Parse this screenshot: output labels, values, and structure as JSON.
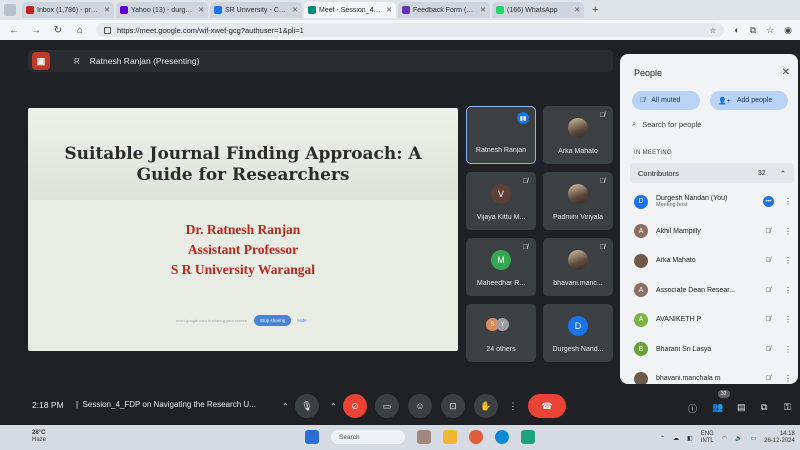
{
  "browser": {
    "tabs": [
      {
        "label": "Inbox (1,786) - prof.durgesh",
        "color": "#c5221f",
        "active": false
      },
      {
        "label": "Yahoo (13) - durgeshnan",
        "color": "#6001d2",
        "active": false
      },
      {
        "label": "SR University - Calendar",
        "color": "#1a73e8",
        "active": false
      },
      {
        "label": "Meet - Session_4_FD",
        "color": "#e8eaed",
        "active": true
      },
      {
        "label": "Feedback Form (Session",
        "color": "#6733b9",
        "active": false
      },
      {
        "label": "(166) WhatsApp",
        "color": "#25d366",
        "active": false
      }
    ],
    "url": "https://meet.google.com/wif-xwef-gcg?authuser=1&pli=1"
  },
  "presenter": {
    "initial": "R",
    "label": "Ratnesh Ranjan (Presenting)"
  },
  "slide": {
    "title_line1": "Suitable Journal Finding Approach: A",
    "title_line2": "Guide for Researchers",
    "author": "Dr. Ratnesh Ranjan",
    "role": "Assistant Professor",
    "org": "S R University Warangal",
    "share_note": "meet.google.com is sharing your screen.",
    "stop_label": "Stop sharing",
    "hide_label": "Hide"
  },
  "tiles": [
    {
      "name": "Ratnesh Ranjan",
      "avatar": "",
      "speaking": true
    },
    {
      "name": "Arka Mahato",
      "avatar": "photo"
    },
    {
      "name": "Vijaya Kittu M...",
      "avatar": "V",
      "color": "#5d4037"
    },
    {
      "name": "Padmini Viriyala",
      "avatar": "photo"
    },
    {
      "name": "Maheedhar R...",
      "avatar": "M",
      "color": "#34a853"
    },
    {
      "name": "bhavani.manc...",
      "avatar": "photo"
    },
    {
      "name": "24 others",
      "a1": "S",
      "a2": "Y"
    },
    {
      "name": "Durgesh Nand...",
      "avatar": "D",
      "color": "#1a73e8"
    }
  ],
  "people": {
    "header": "People",
    "all_muted": "All muted",
    "add_people": "Add people",
    "search_placeholder": "Search for people",
    "section": "IN MEETING",
    "group_label": "Contributors",
    "group_count": "32",
    "list": [
      {
        "name": "Durgesh Nandan (You)",
        "sub": "Meeting host",
        "initial": "D",
        "color": "#1a73e8"
      },
      {
        "name": "Akhil Mampilly",
        "sub": "",
        "initial": "A",
        "color": "#8d6e63"
      },
      {
        "name": "Arka Mahato",
        "sub": "",
        "initial": "",
        "color": "#6d5a4a"
      },
      {
        "name": "Associate Dean Resear...",
        "sub": "",
        "initial": "A",
        "color": "#8d6e63"
      },
      {
        "name": "AVANIKETH P",
        "sub": "",
        "initial": "A",
        "color": "#7cb342"
      },
      {
        "name": "Bharani Sri Lasya",
        "sub": "",
        "initial": "B",
        "color": "#689f38"
      },
      {
        "name": "bhavani.manchala m",
        "sub": "",
        "initial": "",
        "color": "#6d5a4a"
      }
    ]
  },
  "controls": {
    "time": "2:18 PM",
    "title": "Session_4_FDP on Navigating the Research U...",
    "badge": "32"
  },
  "taskbar": {
    "temp": "28°C",
    "weather": "Haze",
    "search": "Search",
    "lang1": "ENG",
    "lang2": "INTL",
    "time": "14:18",
    "date": "26-12-2024"
  }
}
